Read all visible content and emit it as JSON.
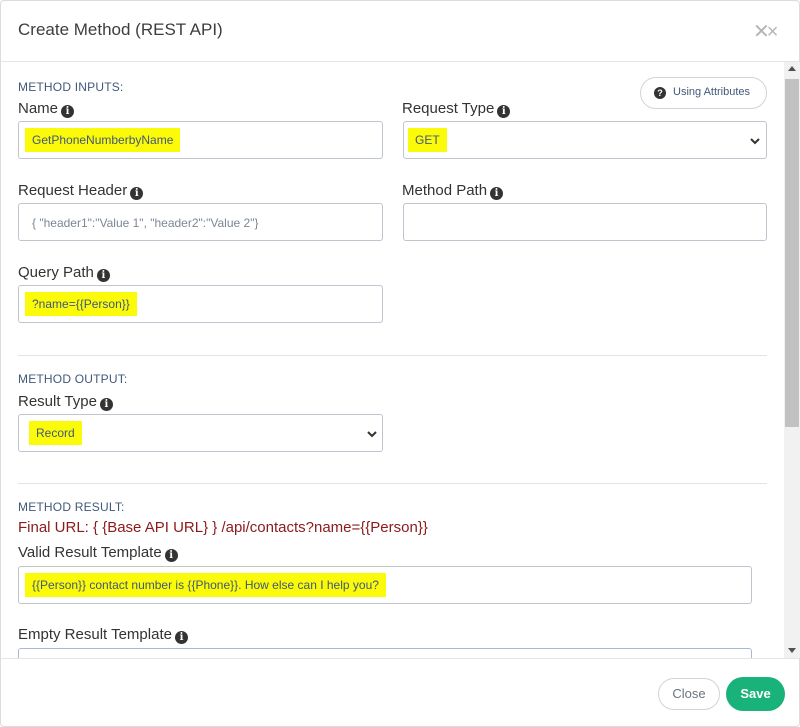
{
  "dialog": {
    "title": "Create Method (REST API)",
    "close_symbol": "✕×"
  },
  "using_attributes": {
    "icon": "question-circle-icon",
    "label": "Using Attributes"
  },
  "method_inputs": {
    "section_label": "METHOD INPUTS:",
    "name": {
      "label": "Name",
      "value": "GetPhoneNumberbyName"
    },
    "request_type": {
      "label": "Request Type",
      "value": "GET"
    },
    "request_header": {
      "label": "Request Header",
      "placeholder": "{ \"header1\":\"Value 1\", \"header2\":\"Value 2\"}"
    },
    "method_path": {
      "label": "Method Path",
      "value": ""
    },
    "query_path": {
      "label": "Query Path",
      "value": "?name={{Person}}"
    }
  },
  "method_output": {
    "section_label": "METHOD OUTPUT:",
    "result_type": {
      "label": "Result Type",
      "value": "Record"
    }
  },
  "method_result": {
    "section_label": "METHOD RESULT:",
    "final_url": "Final URL: { {Base API URL} } /api/contacts?name={{Person}}",
    "valid_template": {
      "label": "Valid Result Template",
      "value": "{{Person}} contact number is {{Phone}}. How else can I help you?"
    },
    "empty_template": {
      "label": "Empty Result Template",
      "value": ""
    }
  },
  "footer": {
    "close_label": "Close",
    "save_label": "Save"
  },
  "colors": {
    "highlight": "#fbfa08",
    "save_green": "#18b27a",
    "final_url_red": "#8b1a1a",
    "section_label_blue": "#41587a"
  }
}
